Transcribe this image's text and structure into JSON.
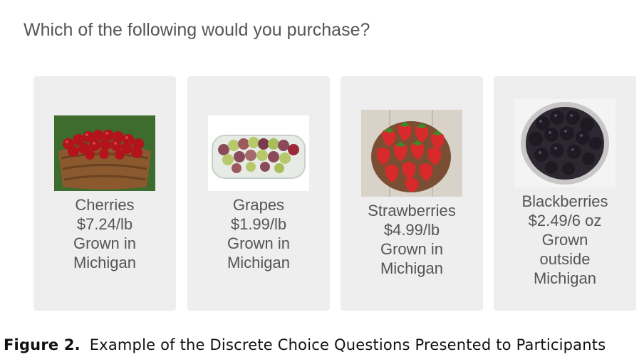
{
  "question": "Which of the following would you purchase?",
  "options": [
    {
      "name": "Cherries",
      "price": "$7.24/lb",
      "origin_line1": "Grown in",
      "origin_line2": "Michigan",
      "image_icon": "cherries-photo"
    },
    {
      "name": "Grapes",
      "price": "$1.99/lb",
      "origin_line1": "Grown in",
      "origin_line2": "Michigan",
      "image_icon": "grapes-photo"
    },
    {
      "name": "Strawberries",
      "price": "$4.99/lb",
      "origin_line1": "Grown in",
      "origin_line2": "Michigan",
      "image_icon": "strawberries-photo"
    },
    {
      "name": "Blackberries",
      "price": "$2.49/6 oz",
      "origin_line1": "Grown",
      "origin_line2": "outside",
      "origin_line3": "Michigan",
      "image_icon": "blackberries-photo"
    }
  ],
  "caption": {
    "figure_number": "Figure 2.",
    "text": "Example of the Discrete Choice Questions Presented to Participants"
  },
  "colors": {
    "card_background": "#eeeeee",
    "text": "#555555",
    "cherry": "#b3141c",
    "grape_green": "#b7c96a",
    "grape_red": "#8a4a5a",
    "strawberry": "#d82a2a",
    "blackberry": "#1e1a24"
  }
}
